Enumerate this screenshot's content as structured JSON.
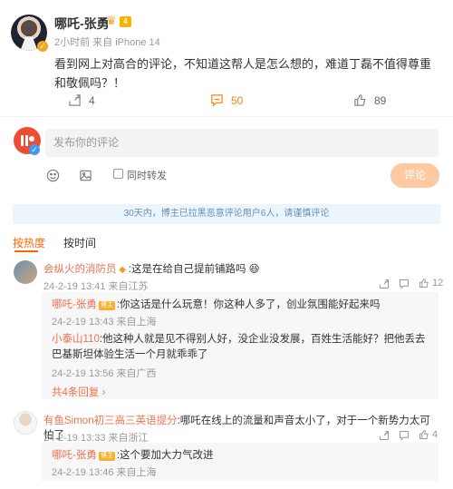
{
  "post": {
    "author": "哪吒-张勇",
    "crown_icon": "crown-icon",
    "vip_badge": "4",
    "meta": "2小时前  来自 iPhone 14",
    "text": "看到网上对高合的评论，不知道这帮人是怎么想的，难道丁磊不值得尊重和敬佩吗？！",
    "repost_count": "4",
    "comment_count": "50",
    "like_count": "89"
  },
  "composer": {
    "placeholder": "发布你的评论",
    "repost_label": "同时转发",
    "submit_label": "评论"
  },
  "notice": "30天内，博主已拉黑恶意评论用户6人，请谨慎评论",
  "tabs": {
    "hot": "按热度",
    "time": "按时间"
  },
  "comments": [
    {
      "user": "会纵火的消防员",
      "text": ":这是在给自己提前铺路吗",
      "meta": "24-2-19 13:41 来自江苏",
      "likes": "12",
      "replies": [
        {
          "user": "哪吒-张勇",
          "tag": "博主",
          "text": ":你这话是什么玩意！你这种人多了，创业氛围能好起来吗",
          "meta": "24-2-19 13:43 来自上海"
        },
        {
          "user": "小泰山110",
          "text": ":他这种人就是见不得别人好，没企业没发展，百姓生活能好？把他丢去巴基斯坦体验生活一个月就乖乖了",
          "meta": "24-2-19 13:56 来自广西"
        }
      ],
      "more": "共4条回复"
    },
    {
      "user": "有鱼Simon初三高三英语提分",
      "text": ":哪吒在线上的流量和声音太小了，对于一个新势力太可怕了",
      "meta": "24-2-19 13:33 来自浙江",
      "likes": "4",
      "replies": [
        {
          "user": "哪吒-张勇",
          "tag": "博主",
          "text": ":这个要加大力气改进",
          "meta": "24-2-19 13:46 来自上海"
        }
      ]
    }
  ]
}
